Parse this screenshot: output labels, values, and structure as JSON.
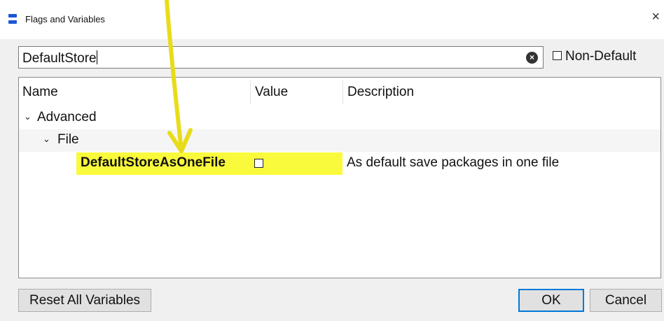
{
  "window": {
    "title": "Flags and Variables",
    "close_glyph": "×"
  },
  "search": {
    "value": "DefaultStore",
    "clear_glyph": "×",
    "non_default_label": "Non-Default"
  },
  "tree": {
    "columns": [
      "Name",
      "Value",
      "Description"
    ],
    "groups": [
      {
        "label": "Advanced",
        "expanded": true
      },
      {
        "label": "File",
        "expanded": true
      }
    ],
    "variable": {
      "name": "DefaultStoreAsOneFile",
      "checked": false,
      "description": "As default save packages in one file"
    }
  },
  "buttons": {
    "reset": "Reset All Variables",
    "ok": "OK",
    "cancel": "Cancel"
  },
  "annotation": {
    "highlight_color": "#fafa3c",
    "arrow_color": "#e8dc1a"
  }
}
